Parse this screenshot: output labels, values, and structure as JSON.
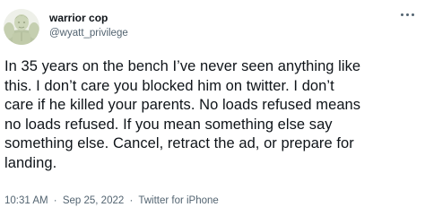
{
  "author": {
    "display_name": "warrior cop",
    "handle": "@wyatt_privilege",
    "avatar_icon": "statue-avatar-icon"
  },
  "menu": {
    "icon": "more-options-icon"
  },
  "tweet": {
    "lines": [
      "In 35 years on the bench I’ve never seen anything like",
      "this. I don’t care you blocked him on twitter. I don’t",
      "care if he killed your parents. No loads refused means",
      "no loads refused. If you mean something else say",
      "something else. Cancel, retract the ad, or prepare for",
      "landing."
    ]
  },
  "meta": {
    "time": "10:31 AM",
    "separator": "·",
    "date": "Sep 25, 2022",
    "source": "Twitter for iPhone"
  }
}
